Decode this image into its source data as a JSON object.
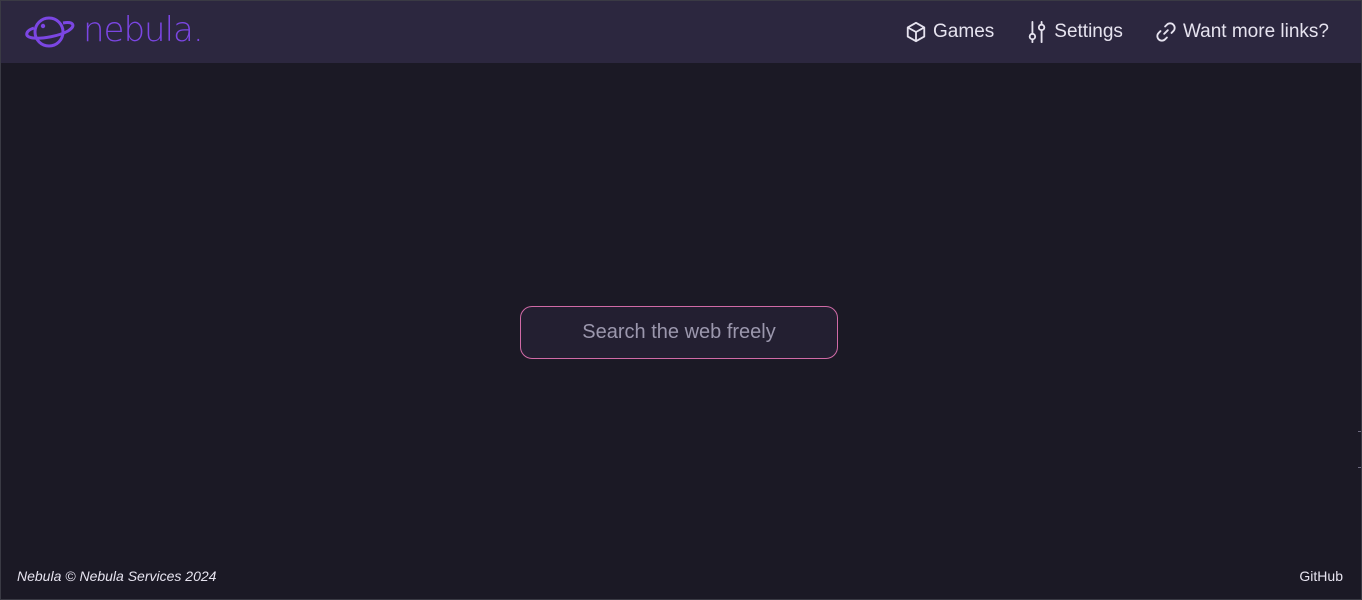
{
  "header": {
    "logo_text": "nebula.",
    "logo_icon": "planet-icon",
    "nav": [
      {
        "label": "Games",
        "icon": "cube-icon"
      },
      {
        "label": "Settings",
        "icon": "sliders-icon"
      },
      {
        "label": "Want more links?",
        "icon": "link-icon"
      }
    ]
  },
  "search": {
    "placeholder": "Search the web freely",
    "value": ""
  },
  "footer": {
    "copyright": "Nebula © Nebula Services 2024",
    "github_label": "GitHub"
  },
  "colors": {
    "brand_purple": "#7b46e3",
    "header_bg": "#2c273f",
    "page_bg": "#1b1925",
    "search_border": "#d06aa6",
    "text": "#e6e3ef"
  }
}
